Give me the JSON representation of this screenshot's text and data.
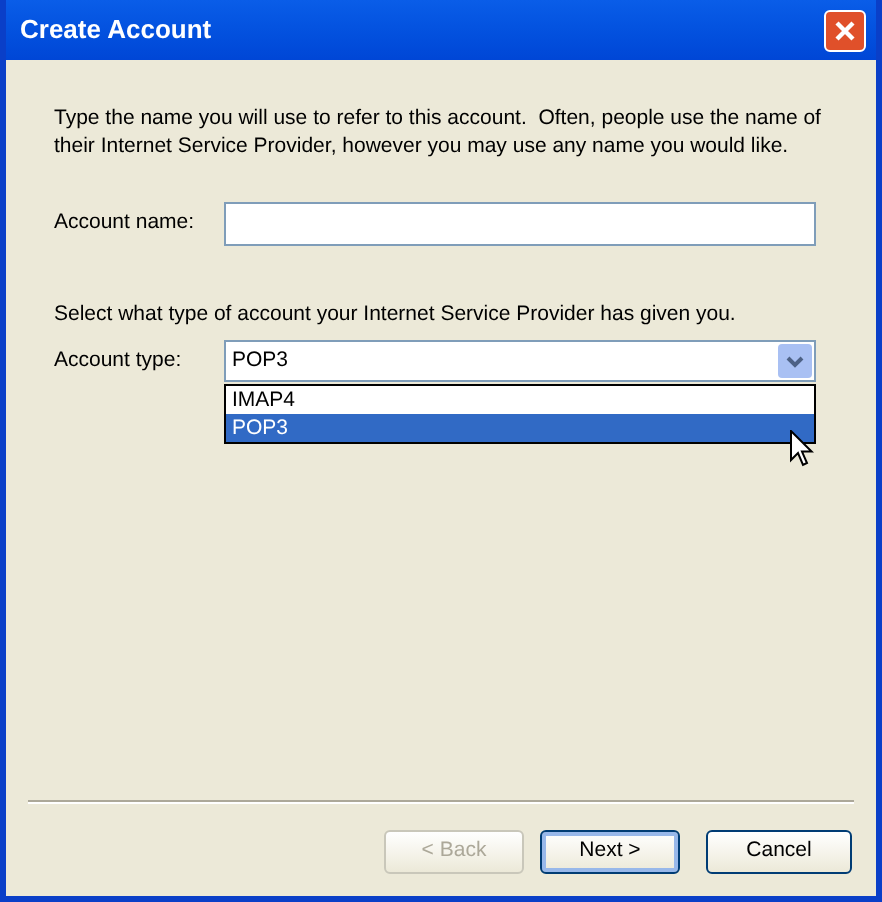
{
  "window": {
    "title": "Create Account"
  },
  "intro": "Type the name you will use to refer to this account.  Often, people use the name of their Internet Service Provider, however you may use any name you would like.",
  "account_name": {
    "label": "Account name:"
  },
  "type_prompt": "Select what type of account your Internet Service Provider has given you.",
  "account_type": {
    "label": "Account type:",
    "value": "POP3",
    "expanded": true,
    "options": [
      {
        "label": "IMAP4",
        "selected": false
      },
      {
        "label": "POP3",
        "selected": true
      }
    ]
  },
  "buttons": [
    {
      "label": "< Back",
      "disabled": true,
      "default": false
    },
    {
      "label": "Next >",
      "disabled": false,
      "default": true
    },
    {
      "label": "Cancel",
      "disabled": false,
      "default": false
    }
  ]
}
